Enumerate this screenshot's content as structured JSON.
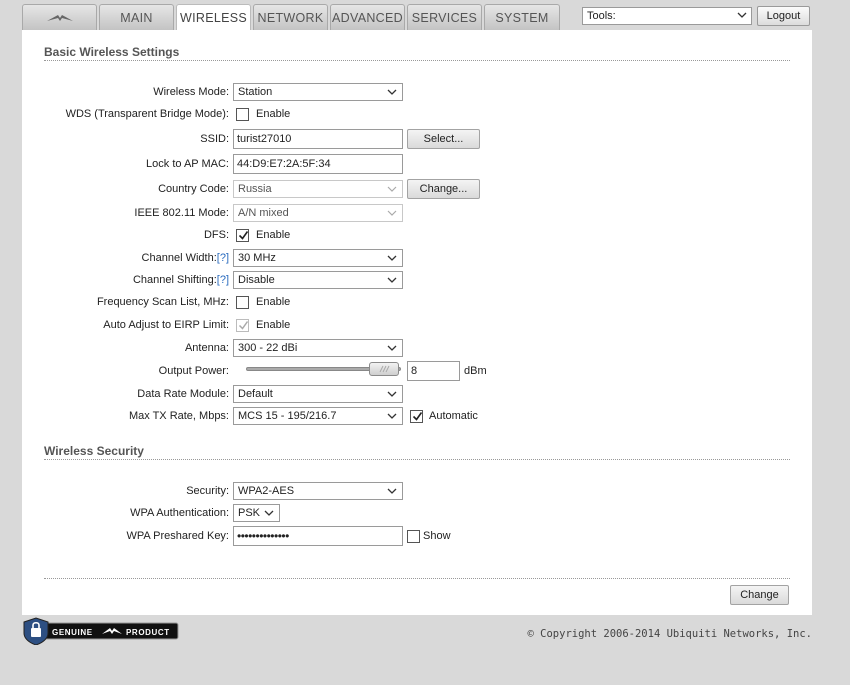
{
  "tabs": {
    "main": "MAIN",
    "wireless": "WIRELESS",
    "network": "NETWORK",
    "advanced": "ADVANCED",
    "services": "SERVICES",
    "system": "SYSTEM"
  },
  "tools": {
    "value": "Tools:"
  },
  "logout_label": "Logout",
  "basic": {
    "title": "Basic Wireless Settings",
    "wireless_mode": {
      "label": "Wireless Mode:",
      "value": "Station"
    },
    "wds": {
      "label": "WDS (Transparent Bridge Mode):",
      "check_label": "Enable",
      "checked": false
    },
    "ssid": {
      "label": "SSID:",
      "value": "turist27010",
      "button": "Select..."
    },
    "lock_ap": {
      "label": "Lock to AP MAC:",
      "value": "44:D9:E7:2A:5F:34"
    },
    "country": {
      "label": "Country Code:",
      "value": "Russia",
      "button": "Change..."
    },
    "ieee": {
      "label": "IEEE 802.11 Mode:",
      "value": "A/N mixed"
    },
    "dfs": {
      "label": "DFS:",
      "check_label": "Enable",
      "checked": true
    },
    "channel_width": {
      "label": "Channel Width:",
      "help": "[?]",
      "value": "30 MHz"
    },
    "channel_shifting": {
      "label": "Channel Shifting:",
      "help": "[?]",
      "value": "Disable"
    },
    "freq_scan": {
      "label": "Frequency Scan List, MHz:",
      "check_label": "Enable",
      "checked": false
    },
    "eirp": {
      "label": "Auto Adjust to EIRP Limit:",
      "check_label": "Enable",
      "checked": true
    },
    "antenna": {
      "label": "Antenna:",
      "value": "300 - 22 dBi"
    },
    "output_power": {
      "label": "Output Power:",
      "value": "8",
      "unit": "dBm",
      "slider_level": 1.0
    },
    "data_rate": {
      "label": "Data Rate Module:",
      "value": "Default"
    },
    "max_tx": {
      "label": "Max TX Rate, Mbps:",
      "value": "MCS 15 - 195/216.7",
      "check_label": "Automatic",
      "checked": true
    }
  },
  "security": {
    "title": "Wireless Security",
    "security": {
      "label": "Security:",
      "value": "WPA2-AES"
    },
    "wpa_auth": {
      "label": "WPA Authentication:",
      "value": "PSK"
    },
    "psk": {
      "label": "WPA Preshared Key:",
      "value": "••••••••••••••",
      "show_label": "Show"
    }
  },
  "change_button": "Change",
  "badge": {
    "left": "GENUINE",
    "right": "PRODUCT"
  },
  "copyright": "© Copyright 2006-2014 Ubiquiti Networks, Inc."
}
